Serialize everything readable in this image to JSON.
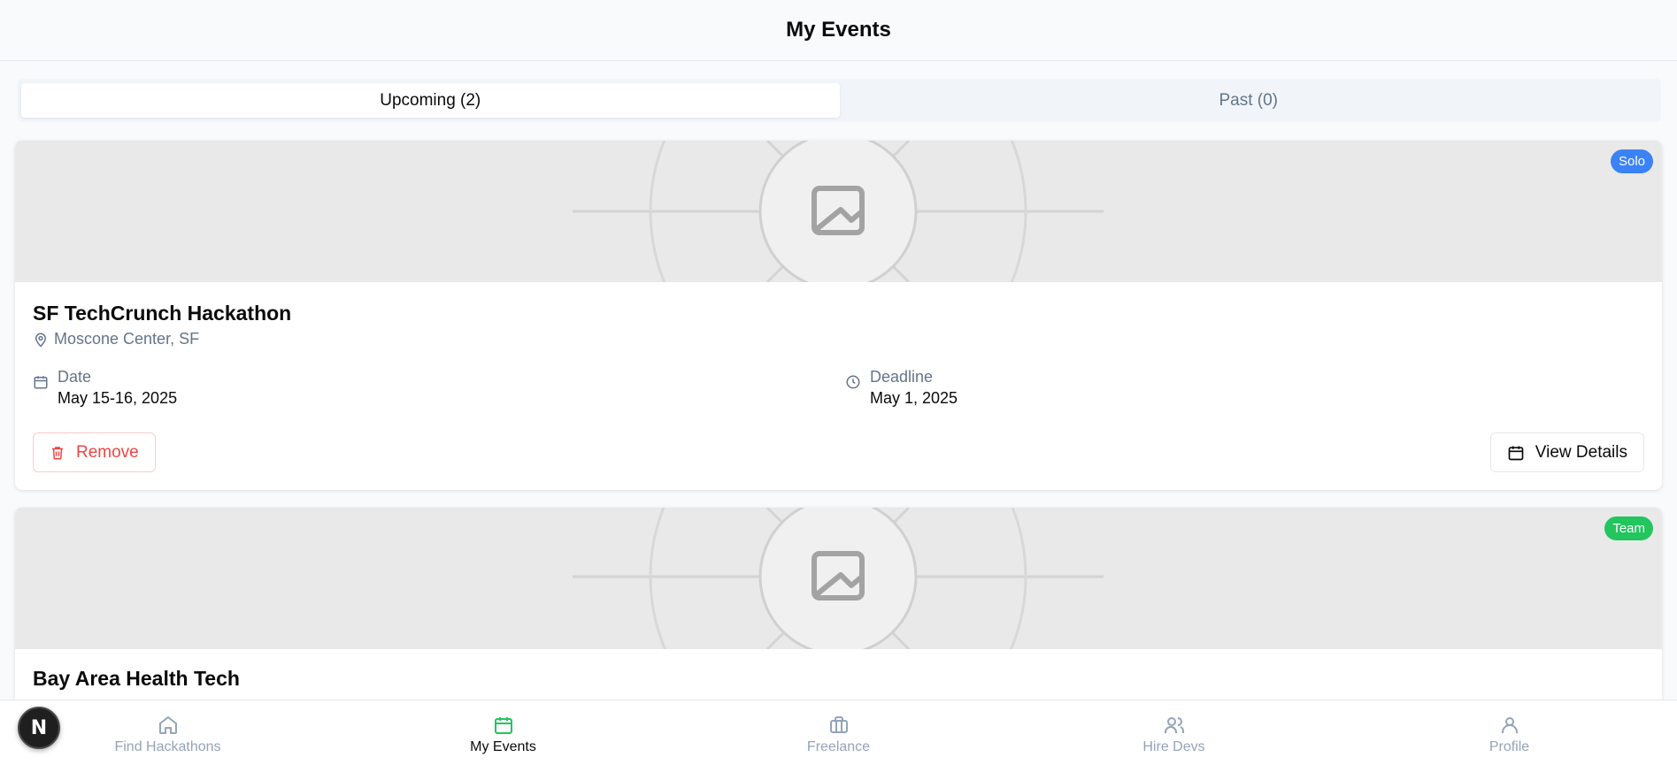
{
  "header": {
    "title": "My Events"
  },
  "tabs": [
    {
      "label": "Upcoming (2)",
      "active": true
    },
    {
      "label": "Past (0)",
      "active": false
    }
  ],
  "events": [
    {
      "badge": "Solo",
      "badge_color": "#3b82f6",
      "title": "SF TechCrunch Hackathon",
      "location": "Moscone Center, SF",
      "date_label": "Date",
      "date_value": "May 15-16, 2025",
      "deadline_label": "Deadline",
      "deadline_value": "May 1, 2025",
      "remove_label": "Remove",
      "details_label": "View Details"
    },
    {
      "badge": "Team",
      "badge_color": "#22c55e",
      "title": "Bay Area Health Tech"
    }
  ],
  "nav": [
    {
      "label": "Find Hackathons",
      "icon": "home-icon",
      "active": false
    },
    {
      "label": "My Events",
      "icon": "calendar-icon",
      "active": true
    },
    {
      "label": "Freelance",
      "icon": "briefcase-icon",
      "active": false
    },
    {
      "label": "Hire Devs",
      "icon": "users-icon",
      "active": false
    },
    {
      "label": "Profile",
      "icon": "user-icon",
      "active": false
    }
  ],
  "accent_color": "#22c55e",
  "next_badge": "N"
}
